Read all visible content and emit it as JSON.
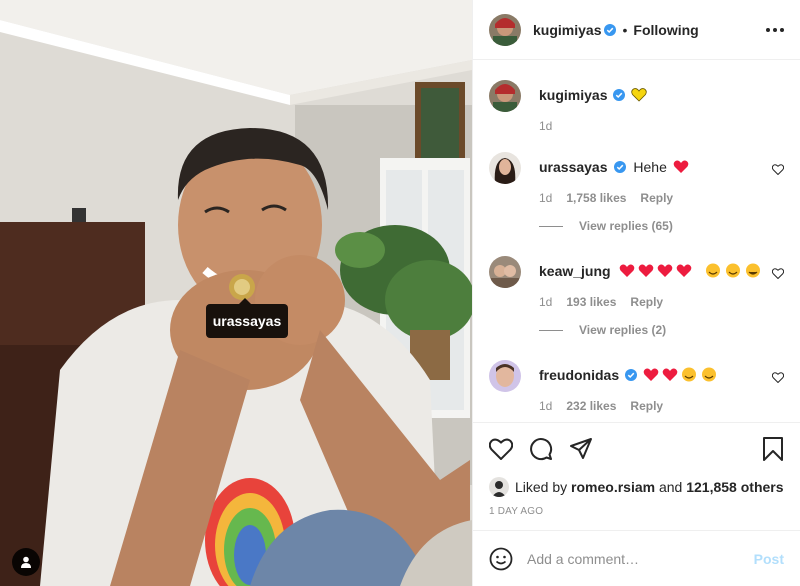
{
  "post": {
    "author": "kugimiyas",
    "follow_status": "Following",
    "dot": "•",
    "caption_time": "1d",
    "photo_tag": "urassayas"
  },
  "comments": [
    {
      "username": "urassayas",
      "text": "Hehe",
      "verified": true,
      "time": "1d",
      "likes": "1,758 likes",
      "reply": "Reply",
      "view_replies": "View replies (65)"
    },
    {
      "username": "keaw_jung",
      "text": "",
      "verified": false,
      "time": "1d",
      "likes": "193 likes",
      "reply": "Reply",
      "view_replies": "View replies (2)"
    },
    {
      "username": "freudonidas",
      "text": "",
      "verified": true,
      "time": "1d",
      "likes": "232 likes",
      "reply": "Reply"
    }
  ],
  "likes_summary": {
    "prefix": "Liked by",
    "user": "romeo.rsiam",
    "connector": "and",
    "others": "121,858 others"
  },
  "date_label": "1 DAY AGO",
  "composer": {
    "placeholder": "Add a comment…",
    "post_label": "Post"
  },
  "colors": {
    "verified_blue": "#3897f0",
    "heart_red": "#ed1c3f",
    "heart_yellow": "#f5d50f",
    "post_button_disabled": "#b2dffc",
    "muted_text": "#8e8e8e"
  },
  "icons": [
    "verified-badge-icon",
    "more-options-icon",
    "heart-icon",
    "comment-icon",
    "share-icon",
    "bookmark-icon",
    "emoji-icon",
    "user-tags-icon"
  ]
}
